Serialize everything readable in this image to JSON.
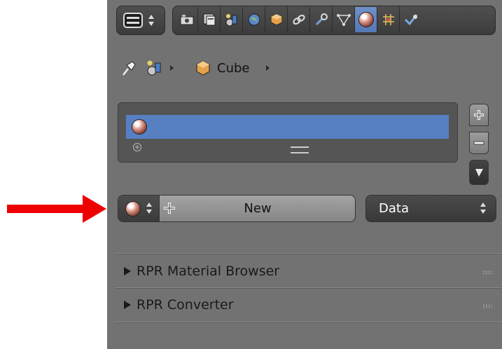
{
  "header": {
    "icons": [
      "render-camera-icon",
      "render-layers-icon",
      "scene-icon",
      "world-icon",
      "object-cube-icon",
      "constraints-icon",
      "modifier-wrench-icon",
      "object-data-icon",
      "material-icon",
      "texture-icon",
      "physics-icon"
    ],
    "active_icon": "material-icon"
  },
  "breadcrumb": {
    "object_name": "Cube"
  },
  "slots": {
    "add_symbol": "+",
    "remove_symbol": "−"
  },
  "material": {
    "new_label": "New",
    "new_icon": "+",
    "link_select": "Data"
  },
  "sections": [
    {
      "label": "RPR Material Browser"
    },
    {
      "label": "RPR Converter"
    }
  ],
  "colors": {
    "panel": "#727272",
    "active_tab": "#5479b6",
    "selected_slot": "#5680c2",
    "arrow": "#ee0000"
  }
}
